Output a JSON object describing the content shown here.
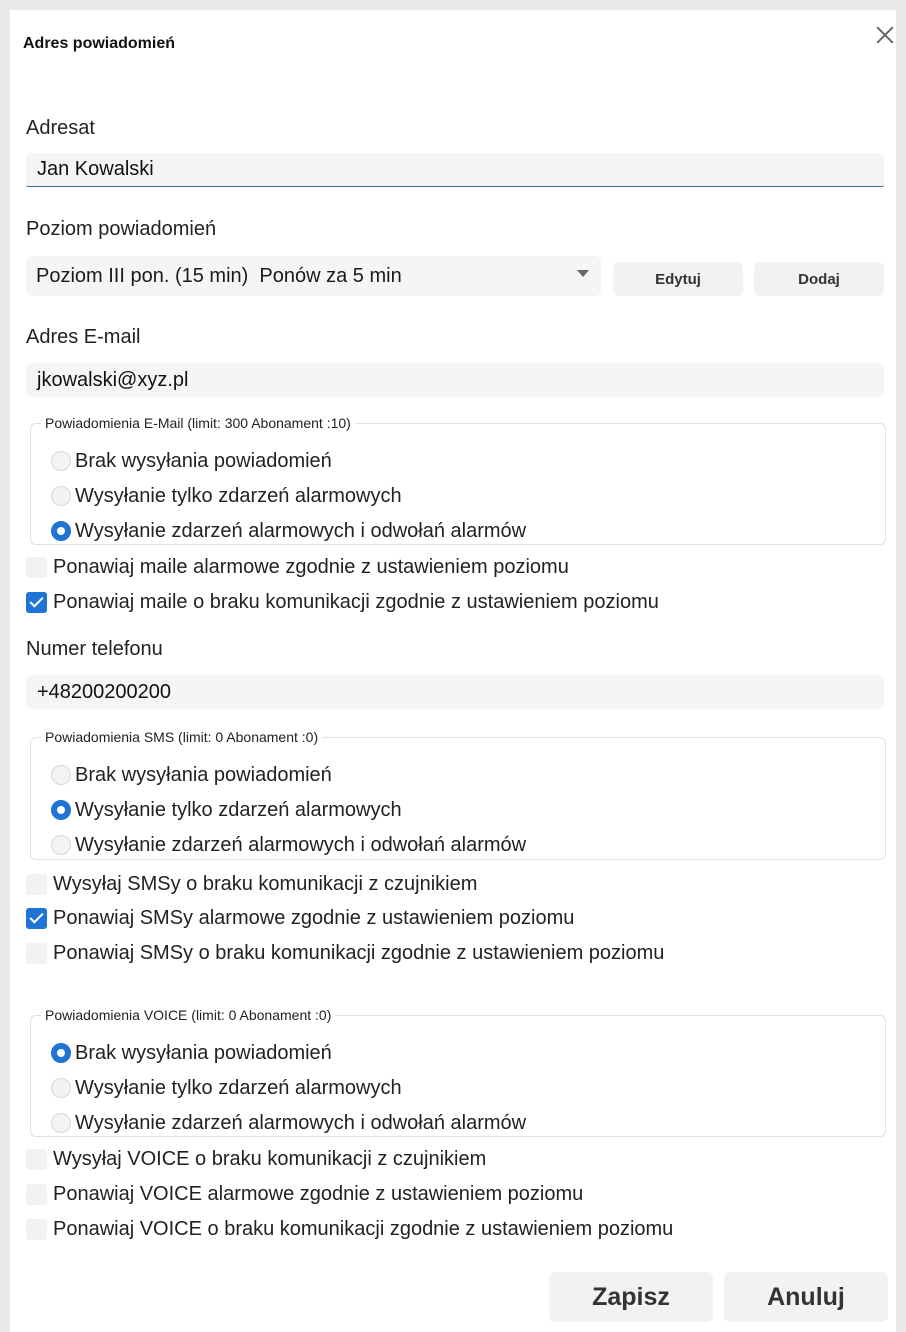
{
  "dialog": {
    "title": "Adres powiadomień",
    "close_icon": "close-icon"
  },
  "recipient": {
    "label": "Adresat",
    "value": "Jan Kowalski"
  },
  "level": {
    "label": "Poziom powiadomień",
    "selected": "Poziom III pon. (15 min)  Ponów za 5 min",
    "edit_label": "Edytuj",
    "add_label": "Dodaj"
  },
  "email": {
    "label": "Adres E-mail",
    "value": "jkowalski@xyz.pl",
    "group_title": "Powiadomienia E-Mail (limit: 300 Abonament :10)",
    "options": [
      {
        "label": "Brak wysyłania powiadomień",
        "selected": false
      },
      {
        "label": "Wysyłanie tylko zdarzeń alarmowych",
        "selected": false
      },
      {
        "label": "Wysyłanie zdarzeń alarmowych i odwołań alarmów",
        "selected": true
      }
    ],
    "checkboxes": [
      {
        "label": "Ponawiaj maile alarmowe zgodnie z ustawieniem poziomu",
        "checked": false
      },
      {
        "label": "Ponawiaj maile o braku komunikacji zgodnie z ustawieniem poziomu",
        "checked": true
      }
    ]
  },
  "phone": {
    "label": "Numer telefonu",
    "value": "+48200200200"
  },
  "sms": {
    "group_title": "Powiadomienia SMS (limit: 0 Abonament :0)",
    "options": [
      {
        "label": "Brak wysyłania powiadomień",
        "selected": false
      },
      {
        "label": "Wysyłanie tylko zdarzeń alarmowych",
        "selected": true
      },
      {
        "label": "Wysyłanie zdarzeń alarmowych i odwołań alarmów",
        "selected": false
      }
    ],
    "checkboxes": [
      {
        "label": "Wysyłaj SMSy o braku komunikacji z czujnikiem",
        "checked": false
      },
      {
        "label": "Ponawiaj SMSy alarmowe zgodnie z ustawieniem poziomu",
        "checked": true
      },
      {
        "label": "Ponawiaj SMSy o braku komunikacji zgodnie z ustawieniem poziomu",
        "checked": false
      }
    ]
  },
  "voice": {
    "group_title": "Powiadomienia VOICE (limit: 0 Abonament :0)",
    "options": [
      {
        "label": "Brak wysyłania powiadomień",
        "selected": true
      },
      {
        "label": "Wysyłanie tylko zdarzeń alarmowych",
        "selected": false
      },
      {
        "label": "Wysyłanie zdarzeń alarmowych i odwołań alarmów",
        "selected": false
      }
    ],
    "checkboxes": [
      {
        "label": "Wysyłaj VOICE o braku komunikacji z czujnikiem",
        "checked": false
      },
      {
        "label": "Ponawiaj VOICE alarmowe zgodnie z ustawieniem poziomu",
        "checked": false
      },
      {
        "label": "Ponawiaj VOICE o braku komunikacji zgodnie z ustawieniem poziomu",
        "checked": false
      }
    ]
  },
  "footer": {
    "save_label": "Zapisz",
    "cancel_label": "Anuluj"
  },
  "colors": {
    "accent": "#1f74d6",
    "background": "#ffffff"
  }
}
